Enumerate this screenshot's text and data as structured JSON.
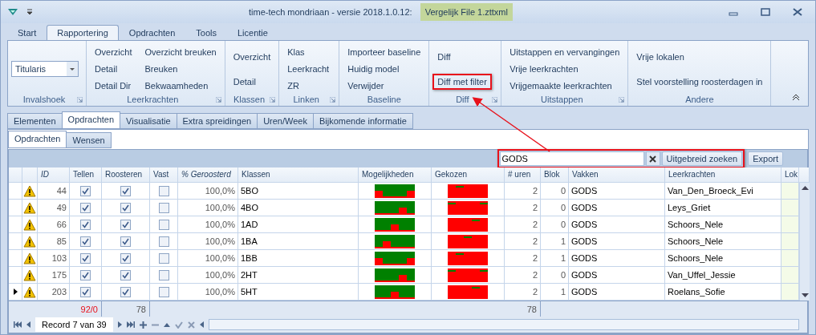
{
  "window": {
    "title": "time-tech mondriaan - versie 2018.1.0.12:",
    "file": "Vergelijk File 1.zttxml"
  },
  "ribbon_tabs": [
    {
      "label": "Start",
      "selected": false
    },
    {
      "label": "Rapportering",
      "selected": true
    },
    {
      "label": "Opdrachten",
      "selected": false
    },
    {
      "label": "Tools",
      "selected": false
    },
    {
      "label": "Licentie",
      "selected": false
    }
  ],
  "ribbon_groups": [
    {
      "title": "Invalshoek",
      "kind": "dropdown",
      "value": "Titularis"
    },
    {
      "title": "Leerkrachten",
      "kind": "buttons",
      "columns": [
        [
          {
            "label": "Overzicht",
            "highlighted": false
          },
          {
            "label": "Detail",
            "highlighted": false
          },
          {
            "label": "Detail Dir",
            "highlighted": false
          }
        ],
        [
          {
            "label": "Overzicht breuken",
            "highlighted": false
          },
          {
            "label": "Breuken",
            "highlighted": false
          },
          {
            "label": "Bekwaamheden",
            "highlighted": false
          }
        ]
      ]
    },
    {
      "title": "Klassen",
      "kind": "buttons",
      "columns": [
        [
          {
            "label": "Overzicht",
            "highlighted": false
          },
          {
            "label": "Detail",
            "highlighted": false
          }
        ]
      ]
    },
    {
      "title": "Linken",
      "kind": "buttons",
      "columns": [
        [
          {
            "label": "Klas",
            "highlighted": false
          },
          {
            "label": "Leerkracht",
            "highlighted": false
          },
          {
            "label": "ZR",
            "highlighted": false
          }
        ]
      ]
    },
    {
      "title": "Baseline",
      "kind": "buttons",
      "columns": [
        [
          {
            "label": "Importeer baseline",
            "highlighted": false
          },
          {
            "label": "Huidig model",
            "highlighted": false
          },
          {
            "label": "Verwijder",
            "highlighted": false
          }
        ]
      ]
    },
    {
      "title": "Diff",
      "kind": "buttons",
      "columns": [
        [
          {
            "label": "Diff",
            "highlighted": false
          },
          {
            "label": "Diff met filter",
            "highlighted": true
          }
        ]
      ]
    },
    {
      "title": "Uitstappen",
      "kind": "buttons",
      "columns": [
        [
          {
            "label": "Uitstappen en vervangingen",
            "highlighted": false
          },
          {
            "label": "Vrije leerkrachten",
            "highlighted": false
          },
          {
            "label": "Vrijgemaakte leerkrachten",
            "highlighted": false
          }
        ]
      ]
    },
    {
      "title": "Andere",
      "kind": "buttons",
      "columns": [
        [
          {
            "label": "Vrije lokalen",
            "highlighted": false
          },
          {
            "label": "Stel voorstelling roosterdagen in",
            "highlighted": false
          }
        ]
      ]
    }
  ],
  "main_tabs": [
    {
      "label": "Elementen",
      "selected": false
    },
    {
      "label": "Opdrachten",
      "selected": true
    },
    {
      "label": "Visualisatie",
      "selected": false
    },
    {
      "label": "Extra spreidingen",
      "selected": false
    },
    {
      "label": "Uren/Week",
      "selected": false
    },
    {
      "label": "Bijkomende informatie",
      "selected": false
    }
  ],
  "sub_tabs": [
    {
      "label": "Opdrachten",
      "selected": true
    },
    {
      "label": "Wensen",
      "selected": false
    }
  ],
  "search": {
    "value": "GODS",
    "highlighted": true,
    "buttons": [
      "Uitgebreid zoeken",
      "Export"
    ]
  },
  "table": {
    "columns": [
      {
        "label": "ID",
        "italic": true
      },
      {
        "label": "Tellen",
        "italic": false
      },
      {
        "label": "Roosteren",
        "italic": false
      },
      {
        "label": "Vast",
        "italic": false
      },
      {
        "label": "% Geroosterd",
        "italic": true
      },
      {
        "label": "Klassen",
        "italic": false
      },
      {
        "label": "Mogelijkheden",
        "italic": false
      },
      {
        "label": "Gekozen",
        "italic": false
      },
      {
        "label": "# uren",
        "italic": false
      },
      {
        "label": "Blok",
        "italic": false
      },
      {
        "label": "Vakken",
        "italic": false
      },
      {
        "label": "Leerkrachten",
        "italic": false
      },
      {
        "label": "Lok",
        "italic": false
      }
    ],
    "rows": [
      {
        "current": false,
        "warning": true,
        "id": "44",
        "tellen": true,
        "roosteren": true,
        "vast": false,
        "percent": "100,0%",
        "klassen": "5BO",
        "uren": "2",
        "blok": "0",
        "vakken": "GODS",
        "leerkrachten": "Van_Den_Broeck_Evi"
      },
      {
        "current": false,
        "warning": true,
        "id": "49",
        "tellen": true,
        "roosteren": true,
        "vast": false,
        "percent": "100,0%",
        "klassen": "4BO",
        "uren": "2",
        "blok": "0",
        "vakken": "GODS",
        "leerkrachten": "Leys_Griet"
      },
      {
        "current": false,
        "warning": true,
        "id": "66",
        "tellen": true,
        "roosteren": true,
        "vast": false,
        "percent": "100,0%",
        "klassen": "1AD",
        "uren": "2",
        "blok": "0",
        "vakken": "GODS",
        "leerkrachten": "Schoors_Nele"
      },
      {
        "current": false,
        "warning": true,
        "id": "85",
        "tellen": true,
        "roosteren": true,
        "vast": false,
        "percent": "100,0%",
        "klassen": "1BA",
        "uren": "2",
        "blok": "1",
        "vakken": "GODS",
        "leerkrachten": "Schoors_Nele"
      },
      {
        "current": false,
        "warning": true,
        "id": "103",
        "tellen": true,
        "roosteren": true,
        "vast": false,
        "percent": "100,0%",
        "klassen": "1BB",
        "uren": "2",
        "blok": "1",
        "vakken": "GODS",
        "leerkrachten": "Schoors_Nele"
      },
      {
        "current": false,
        "warning": true,
        "id": "175",
        "tellen": true,
        "roosteren": true,
        "vast": false,
        "percent": "100,0%",
        "klassen": "2HT",
        "uren": "2",
        "blok": "0",
        "vakken": "GODS",
        "leerkrachten": "Van_Uffel_Jessie"
      },
      {
        "current": true,
        "warning": true,
        "id": "203",
        "tellen": true,
        "roosteren": true,
        "vast": false,
        "percent": "100,0%",
        "klassen": "5HT",
        "uren": "2",
        "blok": "1",
        "vakken": "GODS",
        "leerkrachten": "Roelans_Sofie"
      }
    ],
    "totals": {
      "tellen": "92/0",
      "roosteren": "78",
      "uren": "78"
    }
  },
  "navigator": {
    "record": "Record 7 van 39"
  }
}
